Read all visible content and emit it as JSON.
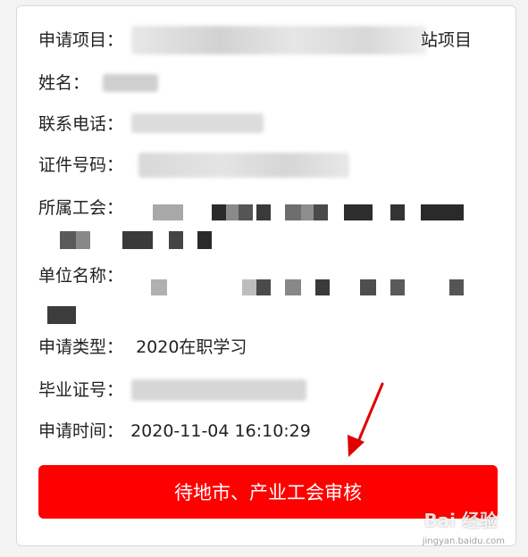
{
  "fields": {
    "project_label": "申请项目：",
    "project_suffix": "站项目",
    "name_label": "姓名：",
    "phone_label": "联系电话：",
    "id_label": "证件号码：",
    "union_label": "所属工会：",
    "employer_label": "单位名称：",
    "type_label": "申请类型：",
    "type_value": "2020在职学习",
    "cert_label": "毕业证号：",
    "time_label": "申请时间：",
    "time_value": "2020-11-04 16:10:29"
  },
  "action": {
    "status_button_label": "待地市、产业工会审核"
  },
  "watermark": {
    "brand": "Bai 经验",
    "url": "jingyan.baidu.com"
  },
  "colors": {
    "accent": "#ff0000",
    "arrow": "#e00000"
  }
}
